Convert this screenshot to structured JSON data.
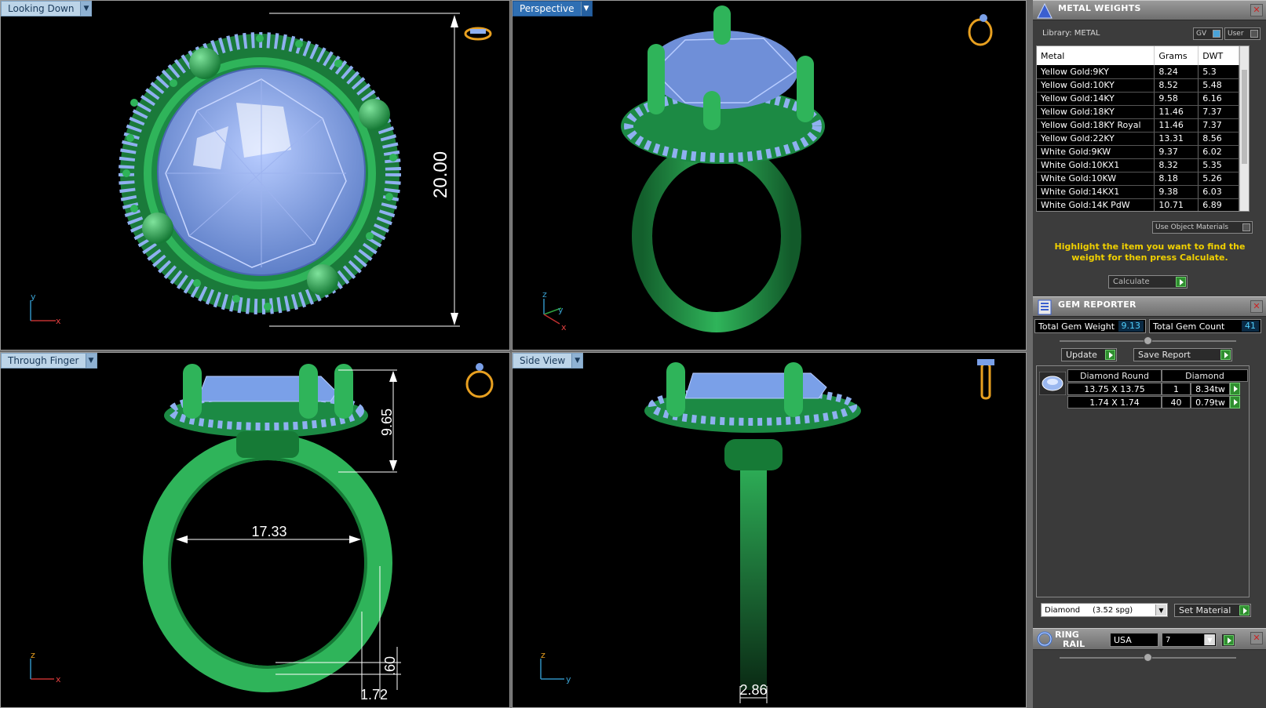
{
  "viewports": {
    "top_left": {
      "label": "Looking Down"
    },
    "top_right": {
      "label": "Perspective"
    },
    "bottom_left": {
      "label": "Through Finger"
    },
    "bottom_right": {
      "label": "Side View"
    }
  },
  "dimensions": {
    "height_top": "20.00",
    "height_front": "9.65",
    "inner_diameter": "17.33",
    "band_thickness": ".60",
    "band_width_front": "1.72",
    "band_width_side": "2.86"
  },
  "axes": {
    "top_left": [
      "y",
      "x"
    ],
    "top_right": [
      "z",
      "y",
      "x"
    ],
    "bottom_left": [
      "z",
      "x"
    ],
    "bottom_right": [
      "z",
      "y"
    ]
  },
  "metal_weights": {
    "title": "METAL WEIGHTS",
    "library_label": "Library: METAL",
    "toggle_gv": "GV",
    "toggle_user": "User",
    "columns": [
      "Metal",
      "Grams",
      "DWT"
    ],
    "rows": [
      [
        "Yellow Gold:9KY",
        "8.24",
        "5.3"
      ],
      [
        "Yellow Gold:10KY",
        "8.52",
        "5.48"
      ],
      [
        "Yellow Gold:14KY",
        "9.58",
        "6.16"
      ],
      [
        "Yellow Gold:18KY",
        "11.46",
        "7.37"
      ],
      [
        "Yellow Gold:18KY Royal",
        "11.46",
        "7.37"
      ],
      [
        "Yellow Gold:22KY",
        "13.31",
        "8.56"
      ],
      [
        "White Gold:9KW",
        "9.37",
        "6.02"
      ],
      [
        "White Gold:10KX1",
        "8.32",
        "5.35"
      ],
      [
        "White Gold:10KW",
        "8.18",
        "5.26"
      ],
      [
        "White Gold:14KX1",
        "9.38",
        "6.03"
      ],
      [
        "White Gold:14K PdW",
        "10.71",
        "6.89"
      ]
    ],
    "use_object_materials": "Use Object Materials",
    "hint": "Highlight the item you want to find the weight for then press Calculate.",
    "calculate": "Calculate"
  },
  "gem_reporter": {
    "title": "GEM REPORTER",
    "total_weight_label": "Total Gem Weight",
    "total_weight_value": "9.13",
    "total_count_label": "Total Gem Count",
    "total_count_value": "41",
    "update": "Update",
    "save_report": "Save Report",
    "group_shape": "Diamond Round",
    "group_material": "Diamond",
    "gems": [
      {
        "size": "13.75 X 13.75",
        "count": "1",
        "weight": "8.34tw"
      },
      {
        "size": "1.74 X 1.74",
        "count": "40",
        "weight": "0.79tw"
      }
    ],
    "material_select": "Diamond     (3.52 spg)",
    "set_material": "Set Material"
  },
  "ring_rail": {
    "title_line1": "RING",
    "title_line2": "RAIL",
    "standard": "USA",
    "size": "7"
  },
  "colors": {
    "metal": "#2fb45a",
    "gem": "#7aa0e8",
    "accent": "#f0d000",
    "view_icon": "#e8a020"
  }
}
